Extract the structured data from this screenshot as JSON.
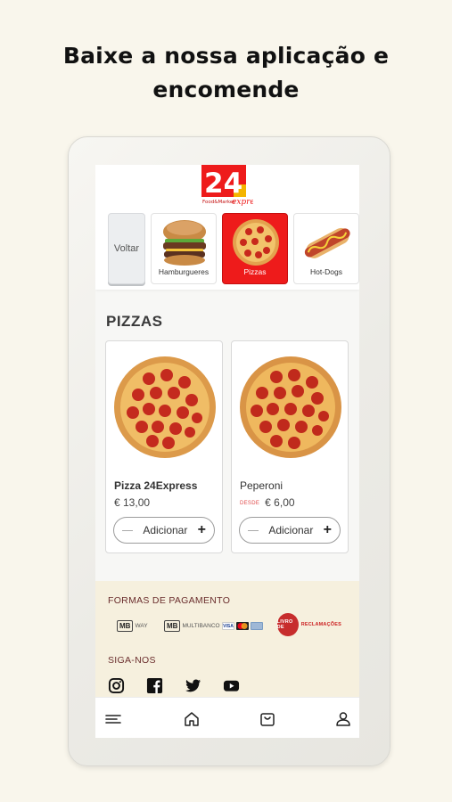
{
  "headline": "Baixe a nossa aplicação e encomende",
  "brand": {
    "logo_text": "24",
    "logo_sub": "Food&Market",
    "logo_script": "express",
    "colors": {
      "primary_red": "#ee1b1b",
      "accent_yellow": "#f4b400"
    }
  },
  "categories": {
    "back_label": "Voltar",
    "items": [
      {
        "label": "Hamburgueres",
        "icon": "burger-image",
        "active": false
      },
      {
        "label": "Pizzas",
        "icon": "pizza-image",
        "active": true
      },
      {
        "label": "Hot-Dogs",
        "icon": "hotdog-image",
        "active": false
      }
    ]
  },
  "section": {
    "title": "PIZZAS"
  },
  "products": [
    {
      "name": "Pizza 24Express",
      "prefix": "",
      "price": "€ 13,00",
      "add_label": "Adicionar"
    },
    {
      "name": "Peperoni",
      "prefix": "DESDE",
      "price": "€ 6,00",
      "add_label": "Adicionar"
    }
  ],
  "footer": {
    "payments_title": "FORMAS DE PAGAMENTO",
    "payment_methods": {
      "mbway": {
        "badge": "MB",
        "label": "WAY"
      },
      "multibanco": {
        "badge": "MB",
        "label": "MULTIBANCO"
      },
      "cards": [
        "VISA",
        "mastercard",
        "card"
      ],
      "complaints": {
        "prefix": "LIVRO DE",
        "label": "RECLAMAÇÕES"
      }
    },
    "social_title": "SIGA-NOS",
    "social_icons": [
      "instagram-icon",
      "facebook-icon",
      "twitter-icon",
      "youtube-icon"
    ]
  },
  "tabbar": [
    "menu-icon",
    "home-icon",
    "bag-icon",
    "profile-icon"
  ]
}
